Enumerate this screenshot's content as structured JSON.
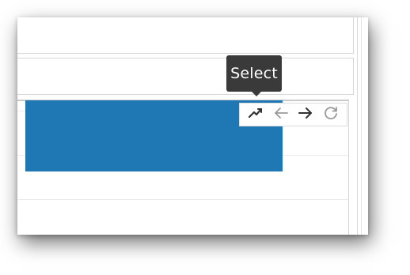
{
  "tooltip": {
    "text": "Select"
  },
  "modebar": {
    "buttons": [
      {
        "icon": "select-line-icon",
        "active": true
      },
      {
        "icon": "arrow-left-icon",
        "active": false
      },
      {
        "icon": "arrow-right-icon",
        "active": true
      },
      {
        "icon": "reset-icon",
        "active": false
      }
    ]
  },
  "colors": {
    "bar": "#1f77b4",
    "tooltip_bg": "#3a3a3a",
    "icon_active": "#333333",
    "icon_muted": "#9a9a9a"
  }
}
